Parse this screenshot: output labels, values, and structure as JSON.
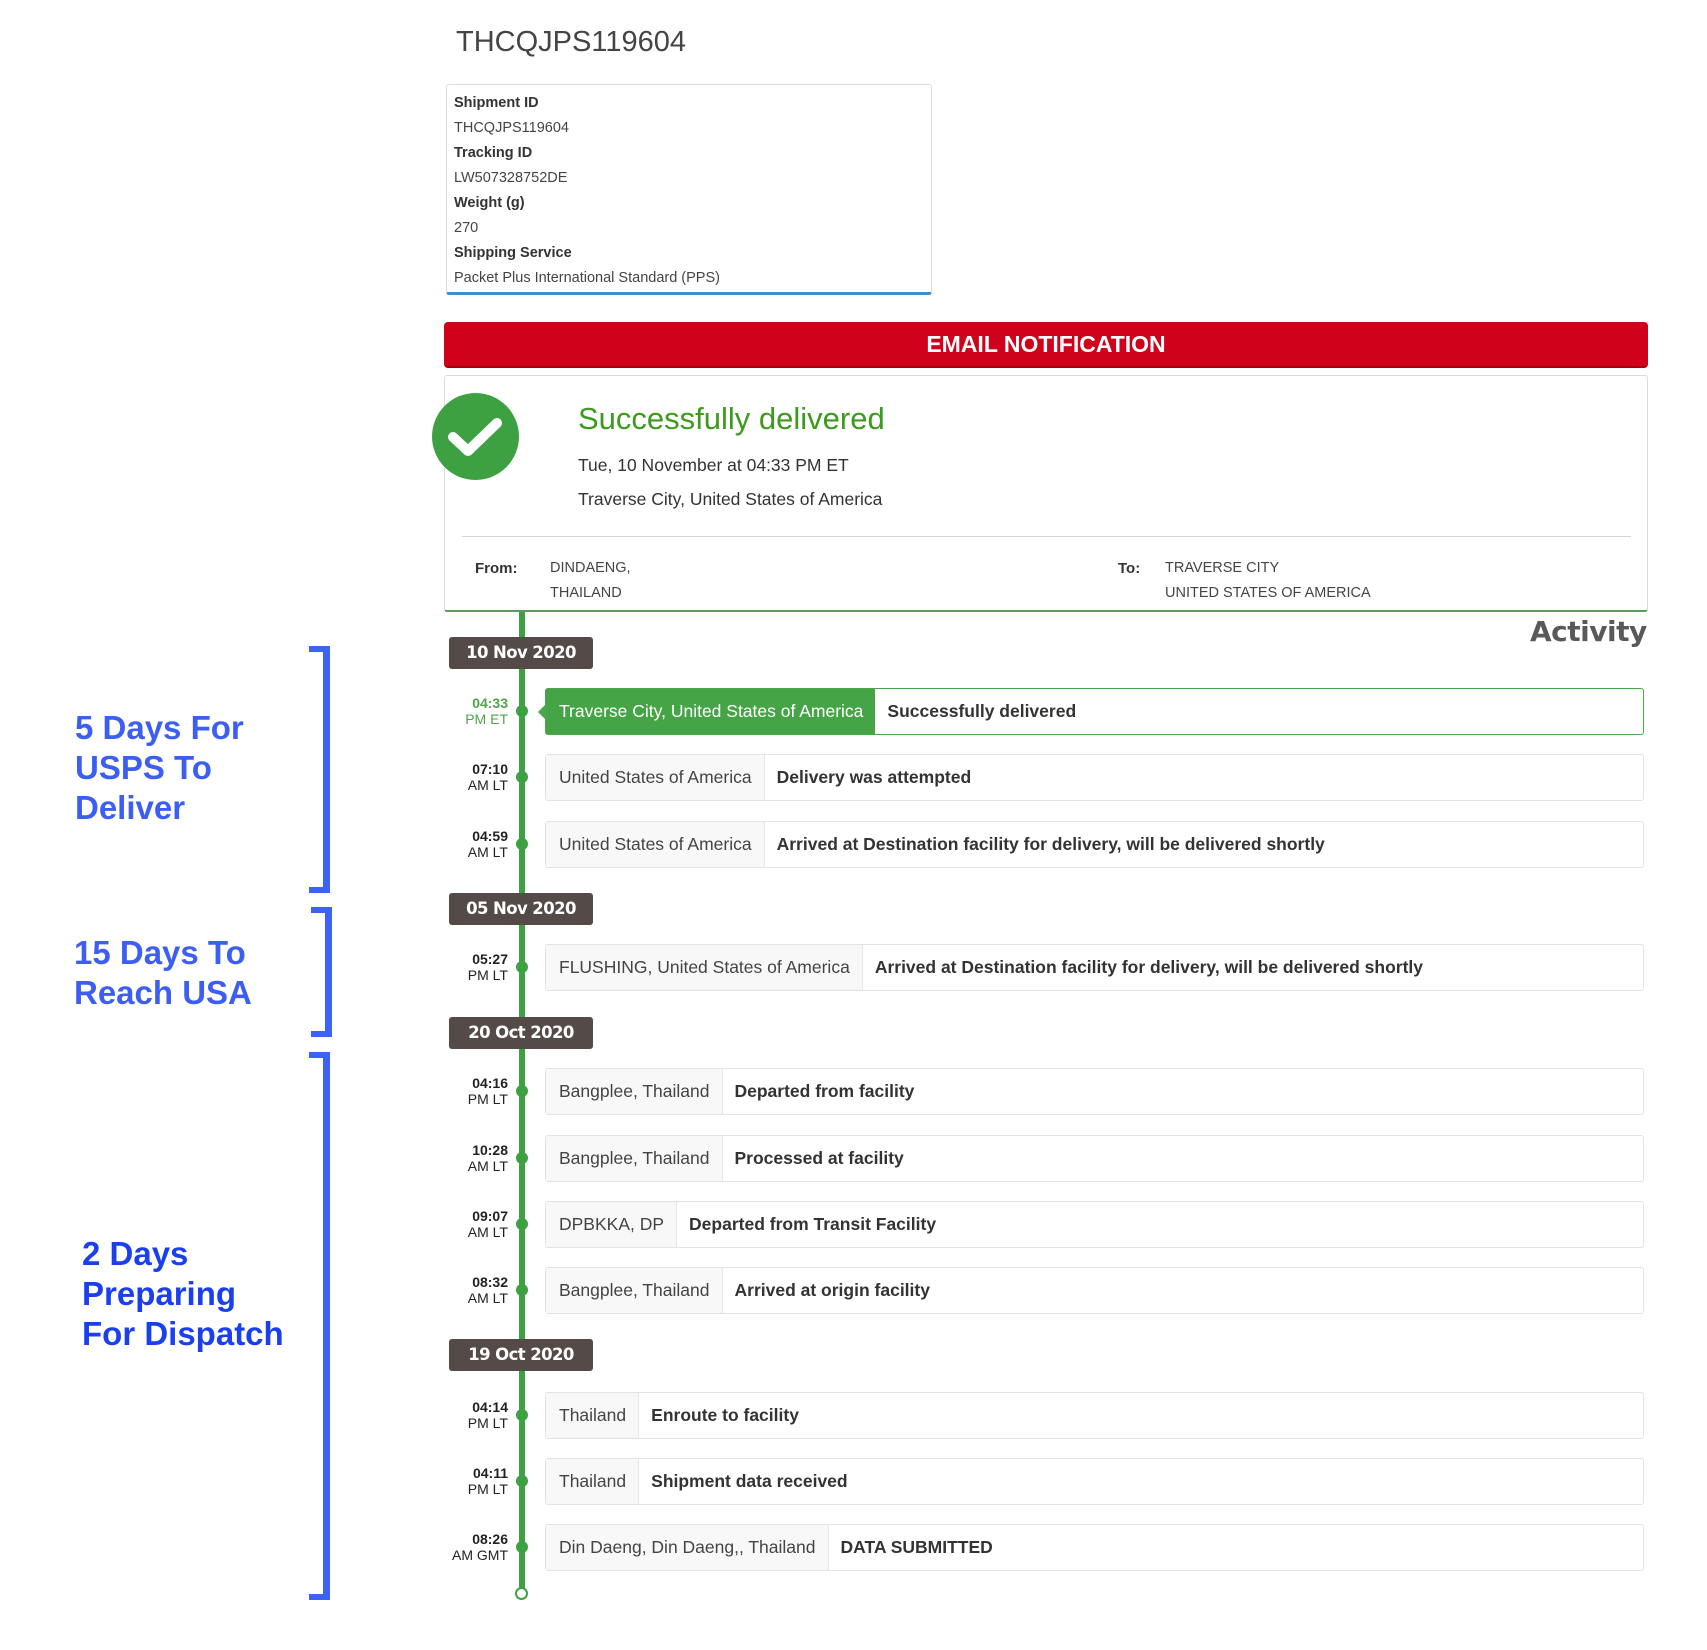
{
  "page_title": "THCQJPS119604",
  "shipment_info": {
    "fields": [
      {
        "label": "Shipment ID",
        "value": "THCQJPS119604"
      },
      {
        "label": "Tracking ID",
        "value": "LW507328752DE"
      },
      {
        "label": "Weight (g)",
        "value": "270"
      },
      {
        "label": "Shipping Service",
        "value": "Packet Plus International Standard (PPS)"
      }
    ]
  },
  "email_button": {
    "label": "EMAIL NOTIFICATION",
    "color": "#d0021b"
  },
  "delivery_status": {
    "icon": "check-circle-icon",
    "title": "Successfully delivered",
    "datetime": "Tue, 10 November at 04:33 PM ET",
    "location": "Traverse City, United States of America",
    "from_label": "From:",
    "from_lines": [
      "DINDAENG,",
      "THAILAND"
    ],
    "to_label": "To:",
    "to_lines": [
      "TRAVERSE CITY",
      "UNITED STATES OF AMERICA"
    ],
    "accent_color": "#3da142"
  },
  "activity": {
    "title": "Activity",
    "groups": [
      {
        "date": "10 Nov 2020",
        "events": [
          {
            "time": "04:33",
            "period": "PM ET",
            "location": "Traverse City, United States of America",
            "description": "Successfully delivered",
            "highlighted": true
          },
          {
            "time": "07:10",
            "period": "AM LT",
            "location": "United States of America",
            "description": "Delivery was attempted"
          },
          {
            "time": "04:59",
            "period": "AM LT",
            "location": "United States of America",
            "description": "Arrived at Destination facility for delivery, will be delivered shortly"
          }
        ]
      },
      {
        "date": "05 Nov 2020",
        "events": [
          {
            "time": "05:27",
            "period": "PM LT",
            "location": "FLUSHING, United States of America",
            "description": "Arrived at Destination facility for delivery, will be delivered shortly"
          }
        ]
      },
      {
        "date": "20 Oct 2020",
        "events": [
          {
            "time": "04:16",
            "period": "PM LT",
            "location": "Bangplee, Thailand",
            "description": "Departed from facility"
          },
          {
            "time": "10:28",
            "period": "AM LT",
            "location": "Bangplee, Thailand",
            "description": "Processed at facility"
          },
          {
            "time": "09:07",
            "period": "AM LT",
            "location": "DPBKKA, DP",
            "description": "Departed from Transit Facility"
          },
          {
            "time": "08:32",
            "period": "AM LT",
            "location": "Bangplee, Thailand",
            "description": "Arrived at origin facility"
          }
        ]
      },
      {
        "date": "19 Oct 2020",
        "events": [
          {
            "time": "04:14",
            "period": "PM LT",
            "location": "Thailand",
            "description": "Enroute to facility"
          },
          {
            "time": "04:11",
            "period": "PM LT",
            "location": "Thailand",
            "description": "Shipment data received"
          },
          {
            "time": "08:26",
            "period": "AM GMT",
            "location": "Din Daeng, Din Daeng,, Thailand",
            "description": "DATA SUBMITTED"
          }
        ]
      }
    ]
  },
  "annotations": [
    {
      "lines": [
        "5 Days For",
        "USPS To",
        "Deliver"
      ]
    },
    {
      "lines": [
        "15 Days To",
        "Reach USA"
      ]
    },
    {
      "lines": [
        "2 Days",
        "Preparing",
        "For Dispatch"
      ]
    }
  ],
  "annotation_color": "#3d5ef3"
}
